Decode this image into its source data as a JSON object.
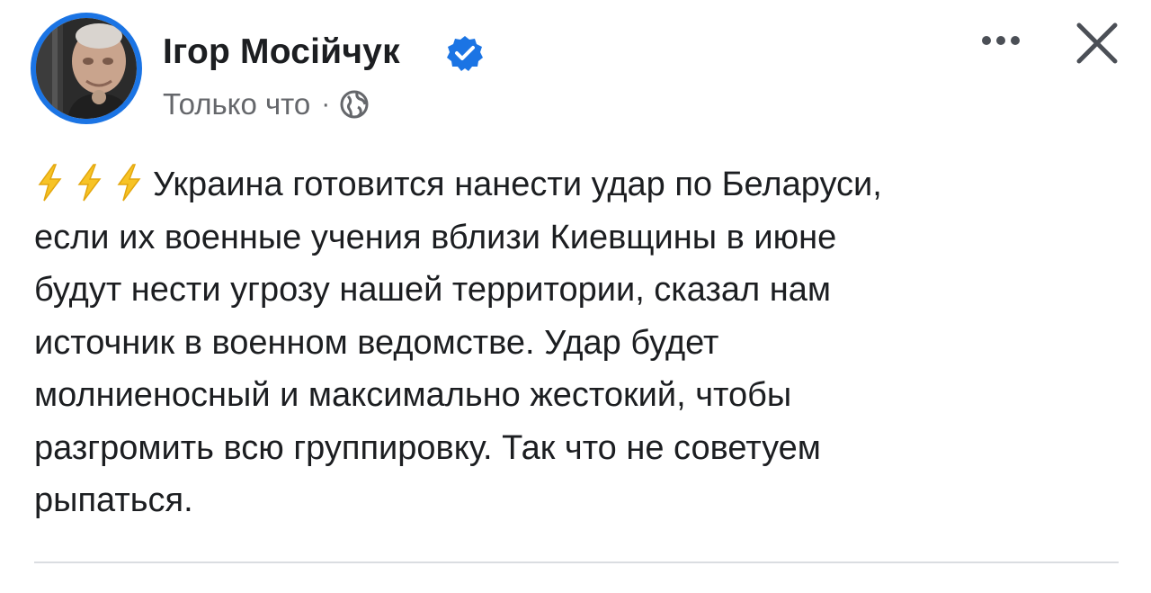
{
  "post": {
    "author": {
      "name": "Ігор Мосійчук",
      "verified": true
    },
    "timestamp": "Только что",
    "separator": "·",
    "audience_icon": "globe-icon",
    "body": {
      "lead_icons": [
        "lightning-icon",
        "lightning-icon",
        "lightning-icon"
      ],
      "lines": [
        "Украина готовится нанести удар по Беларуси,",
        "если их военные учения вблизи Киевщины в июне",
        "будут нести угрозу нашей территории, сказал нам",
        "источник в военном ведомстве. Удар будет",
        "молниеносный и максимально жестокий, чтобы",
        "разгромить всю группировку. Так что не советуем",
        "рыпаться."
      ]
    }
  },
  "icons": {
    "more": "more-dots-icon",
    "close": "close-icon",
    "verified": "verified-badge-icon"
  },
  "colors": {
    "accent": "#1b74e4",
    "text": "#1c1e21",
    "secondary_text": "#65676b",
    "lightning": "#f7c325",
    "divider": "#dadde1"
  }
}
